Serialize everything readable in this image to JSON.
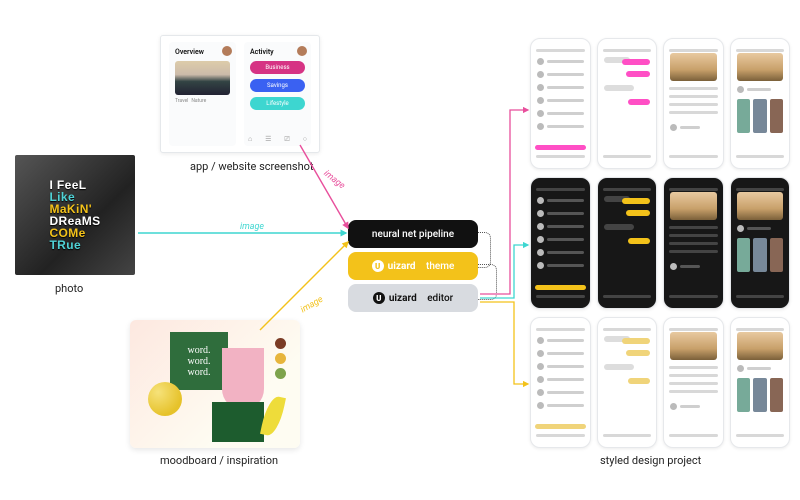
{
  "inputs": {
    "photo": {
      "label": "photo",
      "lines": [
        "I FeeL",
        "Like",
        "MaKiN'",
        "DReaMS",
        "COMe",
        "TRue"
      ]
    },
    "screenshot": {
      "label": "app / website screenshot",
      "left_header": "Overview",
      "left_subs": [
        "Travel",
        "Nature"
      ],
      "right_header": "Activity",
      "pills": [
        "Business",
        "Savings",
        "Lifestyle"
      ]
    },
    "moodboard": {
      "label": "moodboard / inspiration",
      "card_text": "word.\nword.\nword."
    }
  },
  "edges": {
    "image_label": "image",
    "colors": {
      "photo": "#3dd6d0",
      "screenshot": "#e84f9c",
      "moodboard": "#f3c21a"
    }
  },
  "pipeline": {
    "nn_label": "neural net pipeline",
    "theme_label": "theme",
    "editor_label": "editor",
    "brand": "uizard"
  },
  "output": {
    "label": "styled design project",
    "rows": [
      {
        "variant": "light",
        "accent": "#ff4fc5",
        "dark": false
      },
      {
        "variant": "dark",
        "accent": "#f3c21a",
        "dark": true
      },
      {
        "variant": "pastel",
        "accent": "#f0d47a",
        "dark": false
      }
    ]
  },
  "chart_data": {
    "type": "diagram",
    "nodes": [
      {
        "id": "photo",
        "label": "photo"
      },
      {
        "id": "screenshot",
        "label": "app / website screenshot"
      },
      {
        "id": "moodboard",
        "label": "moodboard / inspiration"
      },
      {
        "id": "nn",
        "label": "neural net pipeline"
      },
      {
        "id": "theme",
        "label": "uizard theme"
      },
      {
        "id": "editor",
        "label": "uizard editor"
      },
      {
        "id": "output",
        "label": "styled design project"
      }
    ],
    "edges": [
      {
        "from": "photo",
        "to": "nn",
        "label": "image",
        "color": "#3dd6d0"
      },
      {
        "from": "screenshot",
        "to": "nn",
        "label": "image",
        "color": "#e84f9c"
      },
      {
        "from": "moodboard",
        "to": "nn",
        "label": "image",
        "color": "#f3c21a"
      },
      {
        "from": "nn",
        "to": "theme",
        "style": "dotted"
      },
      {
        "from": "theme",
        "to": "editor",
        "style": "dotted"
      },
      {
        "from": "editor",
        "to": "output",
        "color": "#e84f9c"
      },
      {
        "from": "editor",
        "to": "output",
        "color": "#3dd6d0"
      },
      {
        "from": "editor",
        "to": "output",
        "color": "#f3c21a"
      }
    ]
  }
}
